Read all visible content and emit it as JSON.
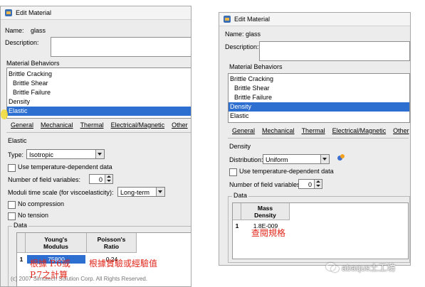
{
  "left_window": {
    "title": "Edit Material",
    "name_label": "Name:",
    "name_value": "glass",
    "description_label": "Description:",
    "behaviors_label": "Material Behaviors",
    "behaviors": [
      "Brittle Cracking",
      "Brittle Shear",
      "Brittle Failure",
      "Density",
      "Elastic"
    ],
    "selected_behavior": "Elastic",
    "menu": [
      "General",
      "Mechanical",
      "Thermal",
      "Electrical/Magnetic",
      "Other"
    ],
    "section_title": "Elastic",
    "type_label": "Type:",
    "type_value": "Isotropic",
    "temp_dependent_label": "Use temperature-dependent data",
    "field_vars_label": "Number of field variables:",
    "field_vars_value": "0",
    "moduli_label": "Moduli time scale (for viscoelasticity):",
    "moduli_value": "Long-term",
    "no_compression_label": "No compression",
    "no_tension_label": "No tension",
    "data_label": "Data",
    "table": {
      "headers": [
        "Young's Modulus",
        "Poisson's Ratio"
      ],
      "row_index": "1",
      "row": [
        "75800",
        "0.24"
      ]
    },
    "copyright": "(c) 2007 Simutech Solution Corp. All Rights Reserved."
  },
  "right_window": {
    "title": "Edit Material",
    "name_label": "Name:",
    "name_value": "glass",
    "description_label": "Description:",
    "behaviors_label": "Material Behaviors",
    "behaviors": [
      "Brittle Cracking",
      "Brittle Shear",
      "Brittle Failure",
      "Density",
      "Elastic"
    ],
    "selected_behavior": "Density",
    "menu": [
      "General",
      "Mechanical",
      "Thermal",
      "Electrical/Magnetic",
      "Other"
    ],
    "section_title": "Density",
    "distribution_label": "Distribution:",
    "distribution_value": "Uniform",
    "temp_dependent_label": "Use temperature-dependent data",
    "field_vars_label": "Number of field variables:",
    "field_vars_value": "0",
    "data_label": "Data",
    "table": {
      "headers": [
        "Mass Density"
      ],
      "row_index": "1",
      "row": [
        "1.8E-009"
      ]
    }
  },
  "annotations": {
    "left_note_1": "根據 P.6或",
    "left_note_2": "P.7之計算",
    "middle_note": "根據實驗或經驗值",
    "right_note": "查閱規格"
  },
  "watermark": "abaqus土工坊",
  "colors": {
    "selection": "#2c6fd1",
    "annotation": "#e0261a"
  }
}
